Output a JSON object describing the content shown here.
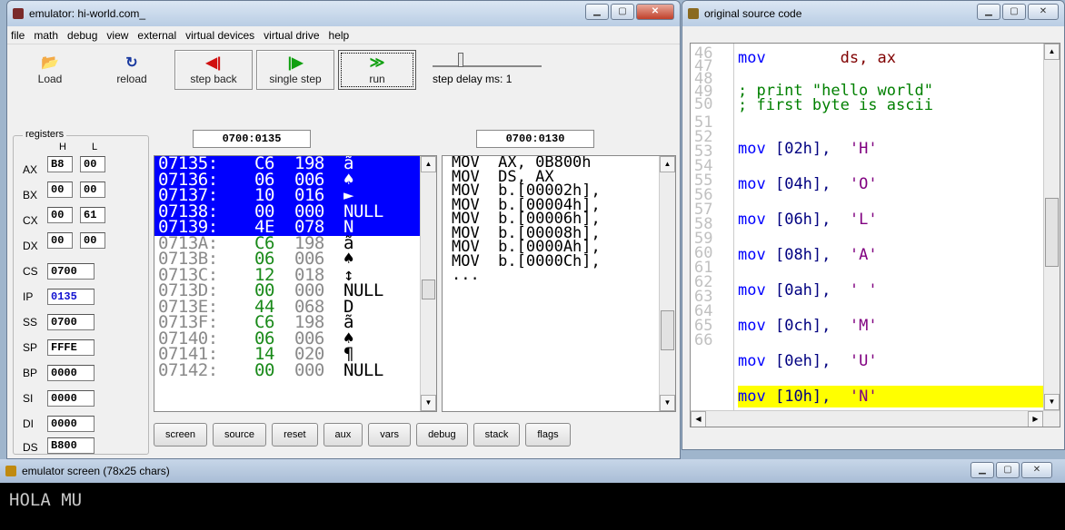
{
  "emu": {
    "title": "emulator: hi-world.com_",
    "menu": [
      "file",
      "math",
      "debug",
      "view",
      "external",
      "virtual devices",
      "virtual drive",
      "help"
    ],
    "toolbar": {
      "load": "Load",
      "reload": "reload",
      "step_back": "step back",
      "single_step": "single step",
      "run": "run",
      "step_delay": "step delay ms: 1"
    },
    "registers_label": "registers",
    "h_label": "H",
    "l_label": "L",
    "regs_hl": [
      {
        "name": "AX",
        "h": "B8",
        "l": "00"
      },
      {
        "name": "BX",
        "h": "00",
        "l": "00"
      },
      {
        "name": "CX",
        "h": "00",
        "l": "61"
      },
      {
        "name": "DX",
        "h": "00",
        "l": "00"
      }
    ],
    "regs_16": [
      {
        "name": "CS",
        "val": "0700"
      },
      {
        "name": "IP",
        "val": "0135"
      },
      {
        "name": "SS",
        "val": "0700"
      },
      {
        "name": "SP",
        "val": "FFFE"
      },
      {
        "name": "BP",
        "val": "0000"
      },
      {
        "name": "SI",
        "val": "0000"
      },
      {
        "name": "DI",
        "val": "0000"
      },
      {
        "name": "DS",
        "val": "B800"
      }
    ],
    "mem_addr": "0700:0135",
    "dis_addr": "0700:0130",
    "memory": [
      {
        "a": "07135:",
        "h": "C6",
        "d": "198",
        "c": "ã"
      },
      {
        "a": "07136:",
        "h": "06",
        "d": "006",
        "c": "♠"
      },
      {
        "a": "07137:",
        "h": "10",
        "d": "016",
        "c": "►"
      },
      {
        "a": "07138:",
        "h": "00",
        "d": "000",
        "c": "NULL"
      },
      {
        "a": "07139:",
        "h": "4E",
        "d": "078",
        "c": "N"
      },
      {
        "a": "0713A:",
        "h": "C6",
        "d": "198",
        "c": "ã"
      },
      {
        "a": "0713B:",
        "h": "06",
        "d": "006",
        "c": "♠"
      },
      {
        "a": "0713C:",
        "h": "12",
        "d": "018",
        "c": "↕"
      },
      {
        "a": "0713D:",
        "h": "00",
        "d": "000",
        "c": "NULL"
      },
      {
        "a": "0713E:",
        "h": "44",
        "d": "068",
        "c": "D"
      },
      {
        "a": "0713F:",
        "h": "C6",
        "d": "198",
        "c": "ã"
      },
      {
        "a": "07140:",
        "h": "06",
        "d": "006",
        "c": "♠"
      },
      {
        "a": "07141:",
        "h": "14",
        "d": "020",
        "c": "¶"
      },
      {
        "a": "07142:",
        "h": "00",
        "d": "000",
        "c": "NULL"
      }
    ],
    "disasm": [
      "MOV  AX, 0B800h",
      "MOV  DS, AX",
      "MOV  b.[00002h],",
      "MOV  b.[00004h],",
      "MOV  b.[00006h],",
      "MOV  b.[00008h],",
      "MOV  b.[0000Ah],",
      "MOV  b.[0000Ch],",
      "..."
    ],
    "bottom_buttons": [
      "screen",
      "source",
      "reset",
      "aux",
      "vars",
      "debug",
      "stack",
      "flags"
    ]
  },
  "src": {
    "title": "original source code",
    "line_numbers": [
      "46",
      "47",
      "48",
      "49",
      "50",
      "51",
      "52",
      "53",
      "54",
      "55",
      "56",
      "57",
      "58",
      "59",
      "60",
      "61",
      "62",
      "63",
      "64",
      "65",
      "66"
    ],
    "line46": {
      "kw": "mov",
      "reg": "ds, ax"
    },
    "comment1": "; print \"hello world\"",
    "comment2": "; first byte is ascii",
    "movs": [
      {
        "addr": "[02h],",
        "ch": "'H'"
      },
      {
        "addr": "[04h],",
        "ch": "'O'"
      },
      {
        "addr": "[06h],",
        "ch": "'L'"
      },
      {
        "addr": "[08h],",
        "ch": "'A'"
      },
      {
        "addr": "[0ah],",
        "ch": "' '"
      },
      {
        "addr": "[0ch],",
        "ch": "'M'"
      },
      {
        "addr": "[0eh],",
        "ch": "'U'"
      },
      {
        "addr": "[10h],",
        "ch": "'N'"
      }
    ],
    "mov_kw": "mov"
  },
  "scr": {
    "title": "emulator screen (78x25 chars)",
    "output": "HOLA MU"
  },
  "colors": {
    "selection": "#0000ff",
    "highlight": "#ffff00",
    "hex": "#1a8a1a"
  }
}
